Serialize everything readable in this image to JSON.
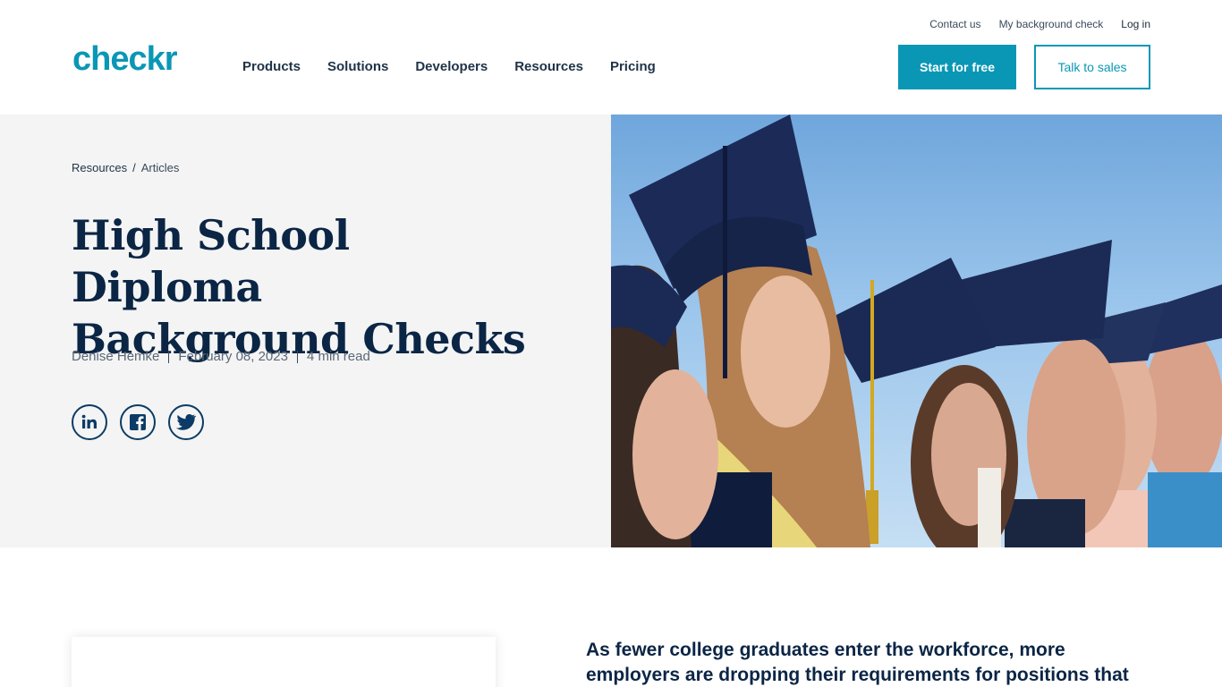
{
  "header": {
    "logo": "checkr",
    "utility_links": [
      "Contact us",
      "My background check",
      "Log in"
    ],
    "nav": [
      "Products",
      "Solutions",
      "Developers",
      "Resources",
      "Pricing"
    ],
    "cta_primary": "Start for free",
    "cta_secondary": "Talk to sales"
  },
  "hero": {
    "breadcrumb": [
      "Resources",
      "Articles"
    ],
    "breadcrumb_separator": "/",
    "title_line1": "High School Diploma",
    "title_line2": "Background Checks",
    "author": "Denise Hemke",
    "date": "February 08, 2023",
    "read_time": "4 min read",
    "social_icons": [
      "linkedin-icon",
      "facebook-icon",
      "twitter-icon"
    ],
    "image_alt": "graduates-photo"
  },
  "article": {
    "lead_line1": "As fewer college graduates enter the workforce, more",
    "lead_line2": "employers are dropping their requirements for positions that"
  },
  "colors": {
    "brand": "#0a97b5",
    "navy": "#0b2545",
    "hero_bg": "#f4f4f4"
  }
}
